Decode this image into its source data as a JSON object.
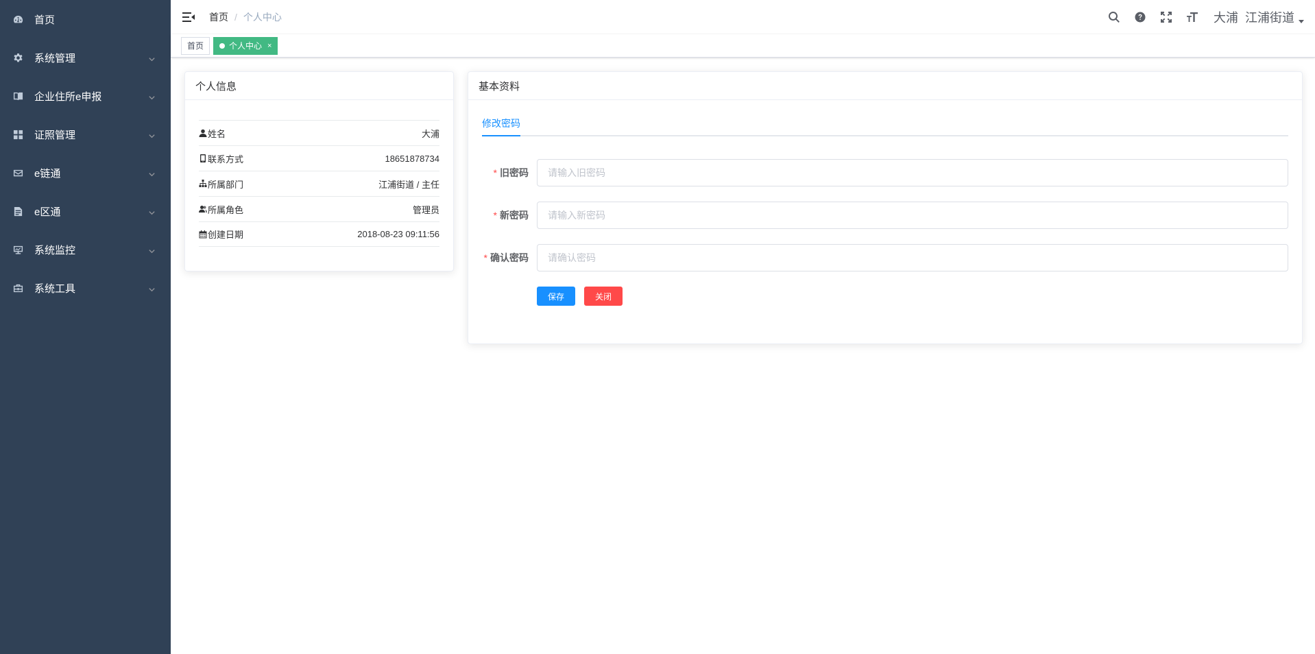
{
  "sidebar": {
    "items": [
      {
        "label": "首页",
        "icon": "dashboard-icon",
        "has_arrow": false
      },
      {
        "label": "系统管理",
        "icon": "gear-icon",
        "has_arrow": true
      },
      {
        "label": "企业住所e申报",
        "icon": "book-icon",
        "has_arrow": true
      },
      {
        "label": "证照管理",
        "icon": "grid-icon",
        "has_arrow": true
      },
      {
        "label": "e链通",
        "icon": "mail-icon",
        "has_arrow": true
      },
      {
        "label": "e区通",
        "icon": "document-icon",
        "has_arrow": true
      },
      {
        "label": "系统监控",
        "icon": "monitor-icon",
        "has_arrow": true
      },
      {
        "label": "系统工具",
        "icon": "toolbox-icon",
        "has_arrow": true
      }
    ],
    "colors": {
      "background": "#304156",
      "text": "#ffffff"
    }
  },
  "navbar": {
    "breadcrumb": {
      "home": "首页",
      "separator": "/",
      "current": "个人中心"
    },
    "username": "大浦  江浦街道"
  },
  "tags": {
    "items": [
      {
        "label": "首页",
        "active": false
      },
      {
        "label": "个人中心",
        "active": true,
        "close": "×"
      }
    ],
    "active_color": "#42b983"
  },
  "profile_card": {
    "title": "个人信息",
    "rows": [
      {
        "icon": "user-icon",
        "key": "姓名",
        "value": "大浦"
      },
      {
        "icon": "phone-icon",
        "key": "联系方式",
        "value": "18651878734"
      },
      {
        "icon": "tree-icon",
        "key": "所属部门",
        "value": "江浦街道 / 主任"
      },
      {
        "icon": "users-icon",
        "key": "所属角色",
        "value": "管理员"
      },
      {
        "icon": "calendar-icon",
        "key": "创建日期",
        "value": "2018-08-23 09:11:56"
      }
    ]
  },
  "basic_card": {
    "title": "基本资料",
    "tab": "修改密码",
    "form": {
      "old_password": {
        "label": "旧密码",
        "placeholder": "请输入旧密码"
      },
      "new_password": {
        "label": "新密码",
        "placeholder": "请输入新密码"
      },
      "confirm_password": {
        "label": "确认密码",
        "placeholder": "请确认密码"
      },
      "required_mark": "*"
    },
    "buttons": {
      "save": "保存",
      "close": "关闭"
    },
    "colors": {
      "primary": "#1890ff",
      "danger": "#ff4949"
    }
  }
}
